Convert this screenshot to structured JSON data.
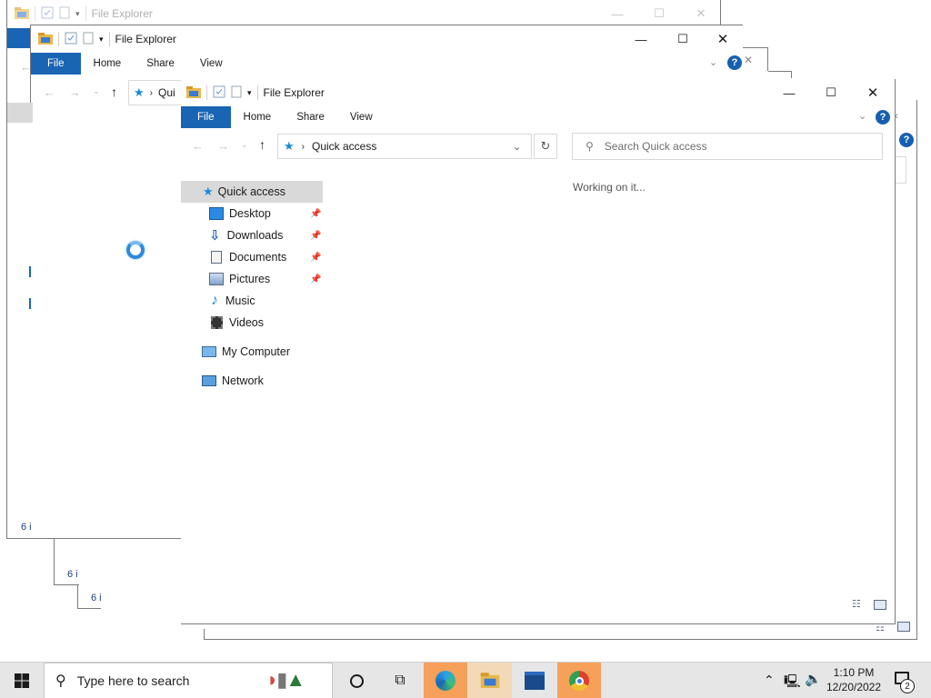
{
  "windows": {
    "back": {
      "title": "File Explorer",
      "status": "6 i"
    },
    "middle": {
      "title": "File Explorer",
      "tabs": [
        "File",
        "Home",
        "Share",
        "View"
      ],
      "address_text": "Qui",
      "status": "6 i"
    },
    "front": {
      "title": "File Explorer",
      "tabs": [
        "File",
        "Home",
        "Share",
        "View"
      ],
      "address": "Quick access",
      "search_placeholder": "Search Quick access",
      "working_text": "Working on it...",
      "nav": [
        {
          "label": "Quick access",
          "icon": "star-icon"
        },
        {
          "label": "Desktop",
          "icon": "desktop-icon"
        },
        {
          "label": "Downloads",
          "icon": "download-icon"
        },
        {
          "label": "Documents",
          "icon": "document-icon"
        },
        {
          "label": "Pictures",
          "icon": "picture-icon"
        },
        {
          "label": "Music",
          "icon": "music-icon"
        },
        {
          "label": "Videos",
          "icon": "video-icon"
        },
        {
          "label": "My Computer",
          "icon": "computer-icon"
        },
        {
          "label": "Network",
          "icon": "network-icon"
        }
      ]
    },
    "third": {
      "status": "6 i"
    }
  },
  "taskbar": {
    "search_placeholder": "Type here to search",
    "time": "1:10 PM",
    "date": "12/20/2022",
    "notification_count": "2"
  },
  "colors": {
    "file_tab": "#1a64b4",
    "active_taskbar": "#f6a05a",
    "selected_nav": "#d9d9d9",
    "accent_blue": "#1560b0"
  }
}
